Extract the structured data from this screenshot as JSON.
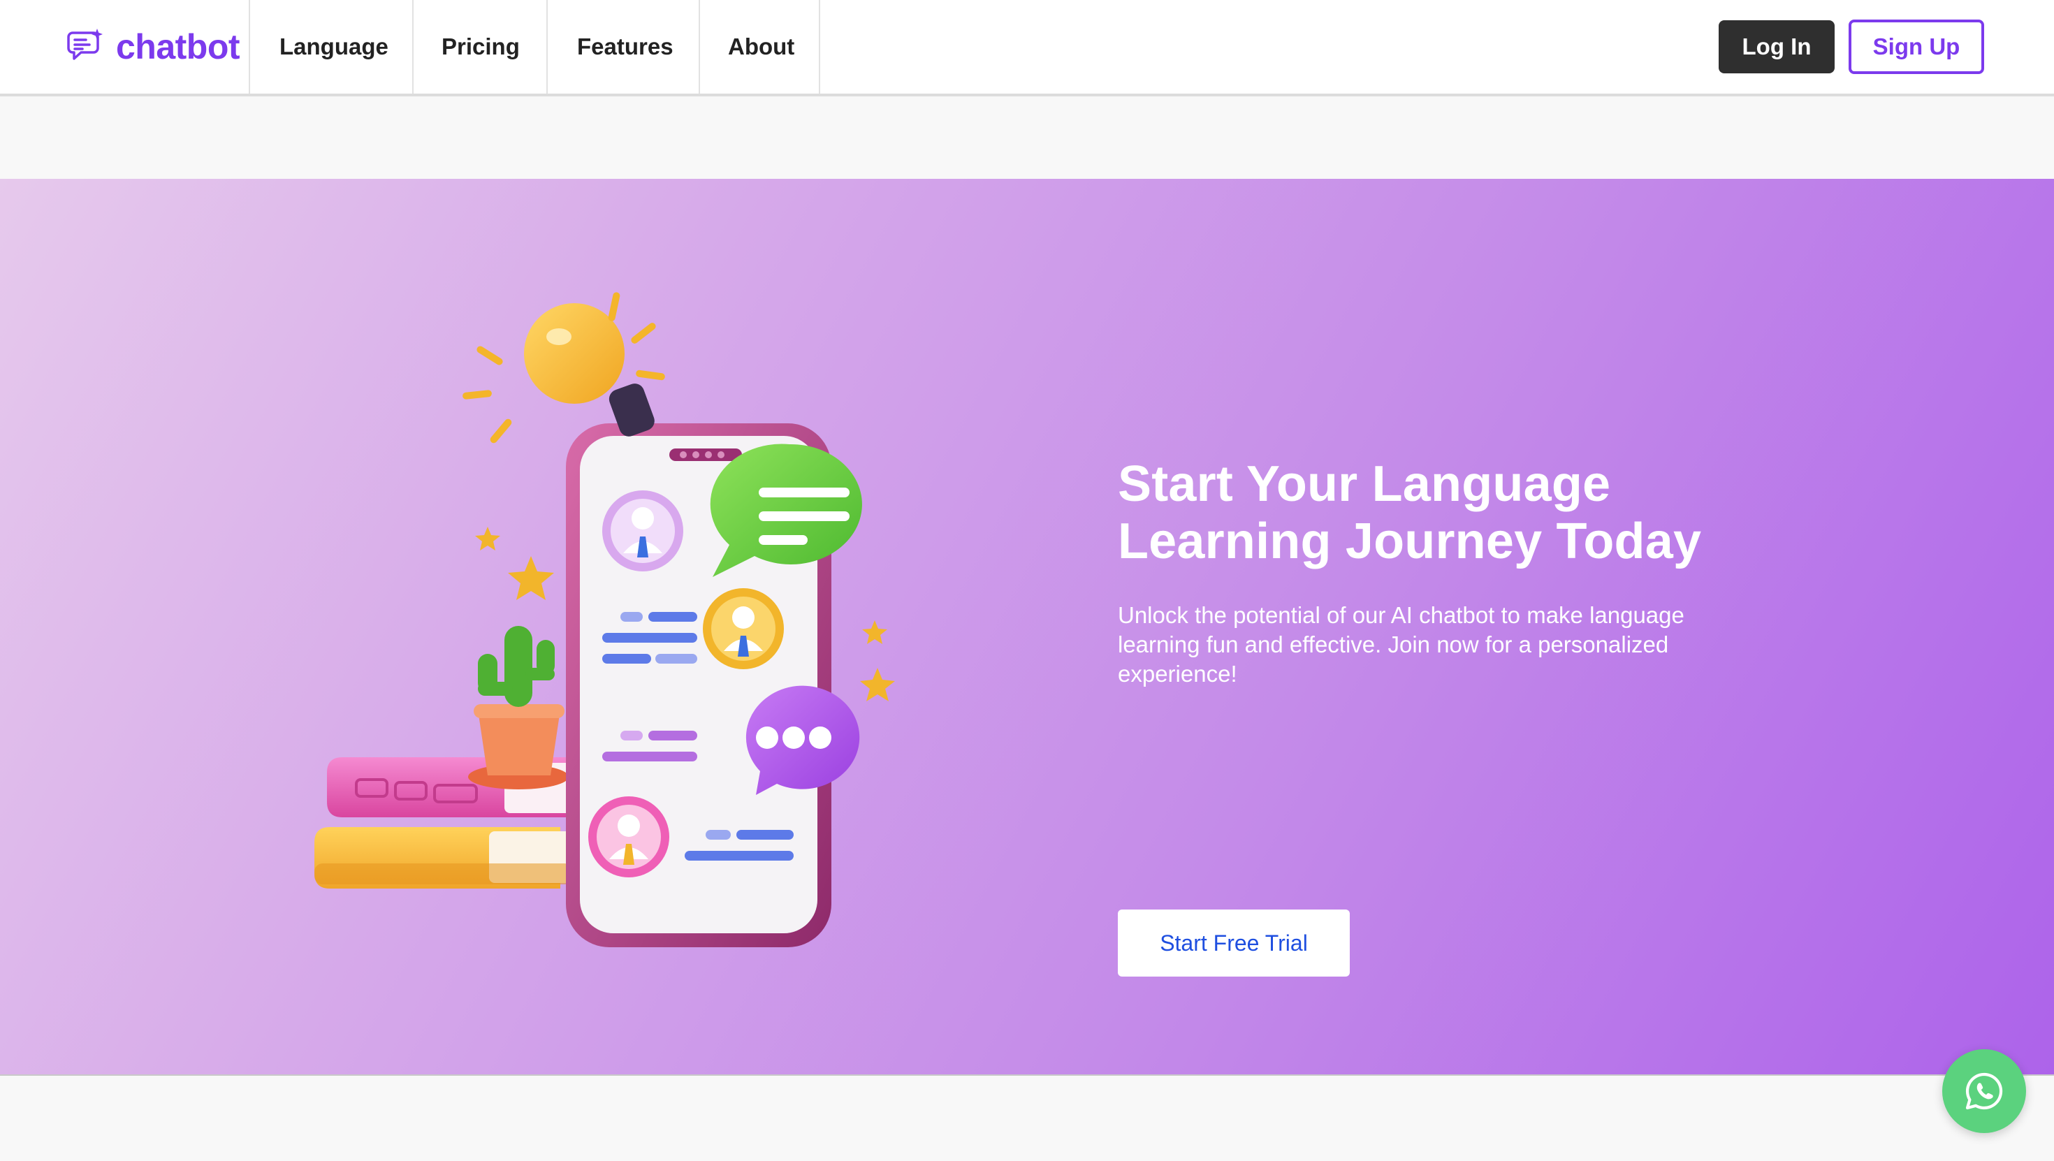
{
  "brand": {
    "name": "chatbot",
    "icon": "chat-sparkle-icon",
    "color": "#7c3aed"
  },
  "nav": {
    "links": [
      {
        "label": "Language"
      },
      {
        "label": "Pricing"
      },
      {
        "label": "Features"
      },
      {
        "label": "About"
      }
    ],
    "login_label": "Log In",
    "signup_label": "Sign Up"
  },
  "hero": {
    "title": "Start Your Language Learning Journey Today",
    "subtitle": "Unlock the potential of our AI chatbot to make language learning fun and effective. Join now for a personalized experience!",
    "cta_label": "Start Free Trial",
    "illustration": "phone-chat-illustration",
    "gradient": [
      "#e6c9ec",
      "#ad63ea"
    ]
  },
  "fab": {
    "icon": "whatsapp-icon",
    "color": "#5bd27e"
  }
}
